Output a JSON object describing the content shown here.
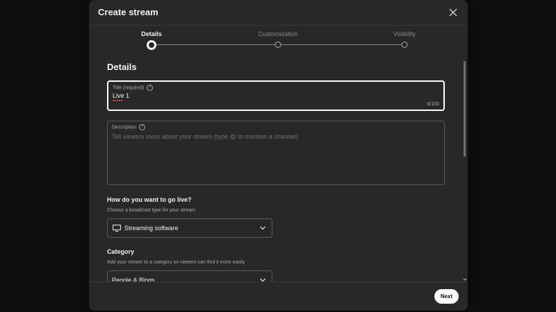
{
  "dialog": {
    "title": "Create stream"
  },
  "steps": [
    {
      "label": "Details",
      "active": true
    },
    {
      "label": "Customization",
      "active": false
    },
    {
      "label": "Visibility",
      "active": false
    }
  ],
  "details": {
    "heading": "Details",
    "title_field": {
      "label": "Title (required)",
      "value": "Live 1",
      "counter": "6/100"
    },
    "description_field": {
      "label": "Description",
      "placeholder": "Tell viewers more about your stream (type @ to mention a channel)"
    },
    "go_live": {
      "question": "How do you want to go live?",
      "subtitle": "Choose a broadcast type for your stream",
      "selected": "Streaming software",
      "icon": "monitor-icon"
    },
    "category": {
      "heading": "Category",
      "subtitle": "Add your stream to a category so viewers can find it more easily",
      "selected": "People & Blogs"
    }
  },
  "footer": {
    "next_label": "Next"
  },
  "colors": {
    "dialog_bg": "#282828",
    "page_bg": "#0f0f0f",
    "button_bg": "#ffffff"
  }
}
